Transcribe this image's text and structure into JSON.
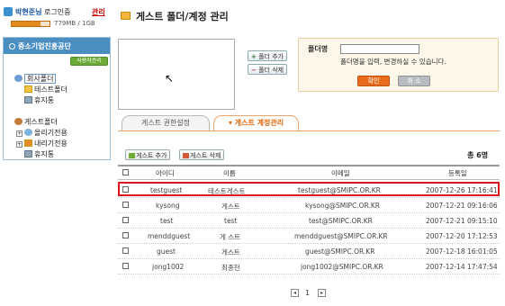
{
  "header": {
    "user_name": "박현준님",
    "login_status": "로그인중",
    "logout_label": "관리",
    "usage": "779MB / 1GB",
    "usage_fraction": 0.76
  },
  "tree": {
    "org_name": "중소기업진흥공단",
    "badge": "사용자관리",
    "nodes": [
      {
        "label": "회사폴더",
        "icon": "users-icon"
      },
      {
        "label": "테스트폴더",
        "icon": "folder-icon"
      },
      {
        "label": "휴지통",
        "icon": "trash-icon"
      },
      {
        "label": "게스트폴더",
        "icon": "guest-folder-icon"
      },
      {
        "label": "올리기전용",
        "icon": "upload-folder-icon"
      },
      {
        "label": "내리기전용",
        "icon": "download-folder-icon"
      },
      {
        "label": "휴지통",
        "icon": "trash-icon"
      }
    ]
  },
  "page": {
    "title": "게스트 폴더/계정 관리"
  },
  "folder_controls": {
    "add_label": "폴더 추가",
    "delete_label": "폴더 삭제",
    "name_label": "폴더명",
    "name_value": "",
    "help_text": "폴더명을 입력, 변경하실 수 있습니다.",
    "confirm_label": "확인",
    "cancel_label": "취 소"
  },
  "tabs": [
    {
      "label": "게스트 권한설정",
      "active": false
    },
    {
      "label": "게스트 계정관리",
      "active": true
    }
  ],
  "actions": {
    "add_guest": "게스트 추가",
    "delete_guest": "게스트 삭제",
    "total": "총 6명"
  },
  "table": {
    "headers": [
      "아이디",
      "이름",
      "이메일",
      "등록일"
    ],
    "rows": [
      {
        "id": "testguest",
        "name": "테스트게스트",
        "email": "testguest@SMIPC.OR.KR",
        "date": "2007-12-26 17:16:41"
      },
      {
        "id": "kysong",
        "name": "게스트",
        "email": "kysong@SMIPC.OR.KR",
        "date": "2007-12-21 09:16:06"
      },
      {
        "id": "test",
        "name": "test",
        "email": "test@SMIPC.OR.KR",
        "date": "2007-12-21 09:15:10"
      },
      {
        "id": "menddguest",
        "name": "게 스트",
        "email": "menddguest@SMIPC.OR.KR",
        "date": "2007-12-20 17:12:53"
      },
      {
        "id": "guest",
        "name": "게스트",
        "email": "guest@SMIPC.OR.KR",
        "date": "2007-12-18 16:01:05"
      },
      {
        "id": "jong1002",
        "name": "최종천",
        "email": "jong1002@SMIPC.OR.KR",
        "date": "2007-12-14 17:47:54"
      }
    ]
  },
  "pagination": {
    "current_page": "1"
  },
  "colors": {
    "accent": "#e06a10",
    "highlight": "#d9141c",
    "tree_header": "#4b8ec2"
  }
}
